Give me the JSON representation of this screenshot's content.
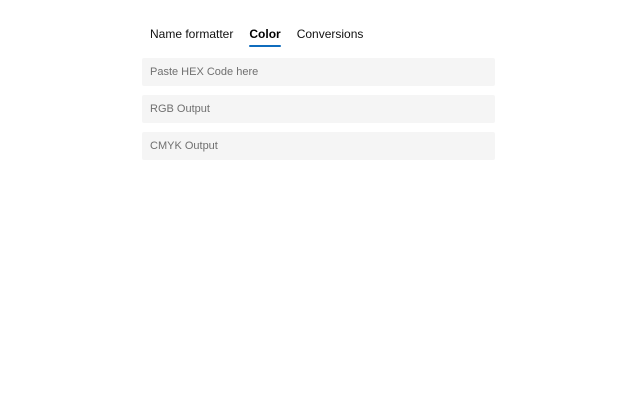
{
  "tabs": [
    {
      "label": "Name formatter",
      "active": false
    },
    {
      "label": "Color",
      "active": true
    },
    {
      "label": "Conversions",
      "active": false
    }
  ],
  "fields": {
    "hex": {
      "value": "",
      "placeholder": "Paste HEX Code here"
    },
    "rgb": {
      "value": "",
      "placeholder": "RGB Output"
    },
    "cmyk": {
      "value": "",
      "placeholder": "CMYK Output"
    }
  },
  "colors": {
    "accent": "#0f6cbd",
    "field_background": "#f5f5f5",
    "placeholder_text": "#707070"
  }
}
